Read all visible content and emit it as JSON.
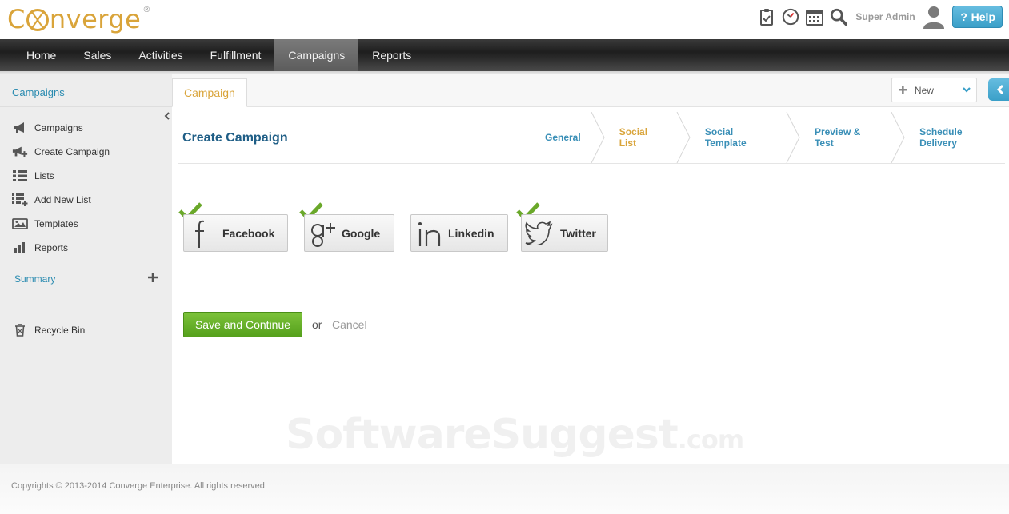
{
  "brand": {
    "name_pre": "C",
    "name_post": "nverge",
    "mark": "®"
  },
  "header": {
    "user_name": "Super Admin",
    "help_label": "Help"
  },
  "nav": {
    "items": [
      {
        "label": "Home"
      },
      {
        "label": "Sales"
      },
      {
        "label": "Activities"
      },
      {
        "label": "Fulfillment"
      },
      {
        "label": "Campaigns"
      },
      {
        "label": "Reports"
      }
    ]
  },
  "sidebar": {
    "heading": "Campaigns",
    "items": [
      {
        "label": "Campaigns",
        "icon": "megaphone-icon"
      },
      {
        "label": "Create Campaign",
        "icon": "megaphone-plus-icon"
      },
      {
        "label": "Lists",
        "icon": "list-icon"
      },
      {
        "label": "Add New List",
        "icon": "list-plus-icon"
      },
      {
        "label": "Templates",
        "icon": "templates-icon"
      },
      {
        "label": "Reports",
        "icon": "bar-chart-icon"
      }
    ],
    "summary_label": "Summary",
    "recycle_label": "Recycle Bin"
  },
  "tabs": {
    "active_label": "Campaign"
  },
  "new_select": {
    "label": "New"
  },
  "page": {
    "title": "Create Campaign"
  },
  "steps": [
    {
      "label": "General"
    },
    {
      "label": "Social List"
    },
    {
      "label": "Social Template"
    },
    {
      "label": "Preview & Test"
    },
    {
      "label": "Schedule Delivery"
    }
  ],
  "socials": [
    {
      "label": "Facebook",
      "checked": true
    },
    {
      "label": "Google",
      "checked": true
    },
    {
      "label": "Linkedin",
      "checked": false
    },
    {
      "label": "Twitter",
      "checked": true
    }
  ],
  "actions": {
    "save_label": "Save and Continue",
    "or_label": "or",
    "cancel_label": "Cancel"
  },
  "watermark": {
    "main": "SoftwareSuggest",
    "suffix": ".com"
  },
  "footer": {
    "text": "Copyrights © 2013-2014 Converge Enterprise. All rights reserved"
  },
  "colors": {
    "accent": "#d9a43a",
    "link": "#2a8bb0",
    "save": "#6ab32a",
    "check": "#6aa82a",
    "help": "#4aa9d2"
  }
}
